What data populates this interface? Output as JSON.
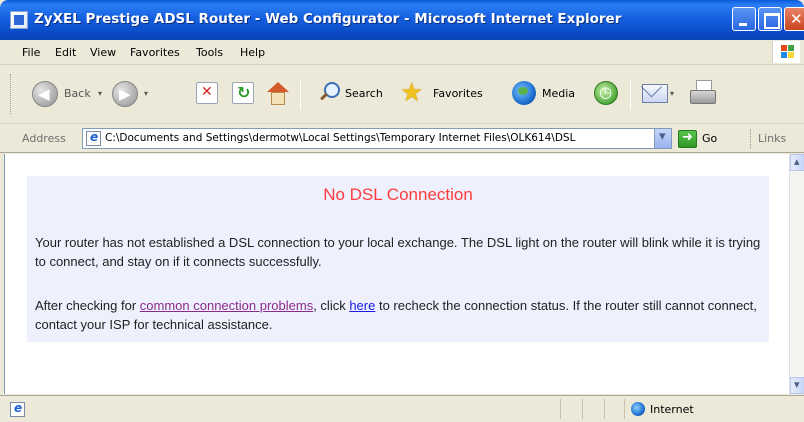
{
  "window": {
    "title": "ZyXEL Prestige ADSL Router - Web Configurator - Microsoft Internet Explorer"
  },
  "menu": {
    "items": [
      "File",
      "Edit",
      "View",
      "Favorites",
      "Tools",
      "Help"
    ]
  },
  "toolbar": {
    "back_label": "Back",
    "search_label": "Search",
    "favorites_label": "Favorites",
    "media_label": "Media"
  },
  "address": {
    "label": "Address",
    "value": "C:\\Documents and Settings\\dermotw\\Local Settings\\Temporary Internet Files\\OLK614\\DSL",
    "go_label": "Go",
    "links_label": "Links"
  },
  "page": {
    "title": "No DSL Connection",
    "para1": "Your router has not established a DSL connection to your local exchange. The DSL light on the router will blink while it is trying to connect, and stay on if it connects successfully.",
    "para2_before": "After checking for ",
    "para2_link1": "common connection problems",
    "para2_middle": ", click ",
    "para2_link2": "here",
    "para2_after": " to recheck the connection status. If the router still cannot connect, contact your ISP for technical assistance.",
    "title_color": "#ff3c3c",
    "panel_color": "#eef1fd"
  },
  "status": {
    "zone_label": "Internet"
  }
}
